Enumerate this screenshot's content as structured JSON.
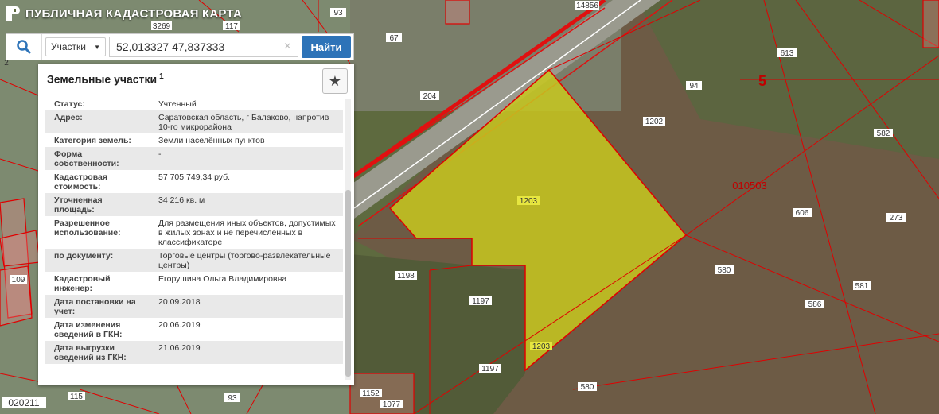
{
  "header": {
    "title": "ПУБЛИЧНАЯ КАДАСТРОВАЯ КАРТА"
  },
  "search": {
    "category": "Участки",
    "query": "52,013327 47,837333",
    "button": "Найти",
    "icon": "search-icon"
  },
  "panel": {
    "title": "Земельные участки",
    "count": "1",
    "star_icon": "star-icon",
    "rows": [
      {
        "k": "Статус:",
        "v": "Учтенный"
      },
      {
        "k": "Адрес:",
        "v": "Саратовская область, г Балаково, напротив 10-го микрорайона"
      },
      {
        "k": "Категория земель:",
        "v": "Земли населённых пунктов"
      },
      {
        "k": "Форма собственности:",
        "v": "-"
      },
      {
        "k": "Кадастровая стоимость:",
        "v": "57 705 749,34 руб."
      },
      {
        "k": "Уточненная площадь:",
        "v": "34 216 кв. м"
      },
      {
        "k": "Разрешенное использование:",
        "v": "Для размещения иных объектов, допустимых в жилых зонах и не перечисленных в классификаторе"
      },
      {
        "k": "по документу:",
        "v": "Торговые центры (торгово-развлекательные центры)"
      },
      {
        "k": "Кадастровый инженер:",
        "v": "Егорушина Ольга Владимировна"
      },
      {
        "k": "Дата постановки на учет:",
        "v": "20.09.2018"
      },
      {
        "k": "Дата изменения сведений в ГКН:",
        "v": "20.06.2019"
      },
      {
        "k": "Дата выгрузки сведений из ГКН:",
        "v": "21.06.2019"
      }
    ]
  },
  "map": {
    "labels": [
      "3269",
      "117",
      "93",
      "14856",
      "67",
      "613",
      "5",
      "204",
      "94",
      "1202",
      "582",
      "010503",
      "606",
      "273",
      "1203",
      "1198",
      "580",
      "1197",
      "581",
      "586",
      "1203",
      "1197",
      "580",
      "93",
      "1152",
      "1077",
      "115",
      "109",
      "020211",
      "2"
    ]
  },
  "colors": {
    "accent": "#2d73b8",
    "parcel_fill": "#c8c81e",
    "parcel_line": "#e00000"
  }
}
